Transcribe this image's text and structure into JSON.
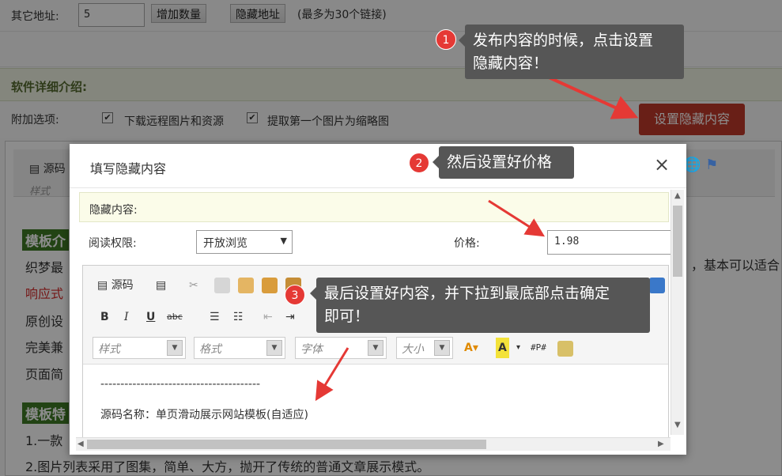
{
  "form": {
    "other_address_label": "其它地址:",
    "address_count_value": "5",
    "add_count_button": "增加数量",
    "hide_address_button": "隐藏地址",
    "max_links_note": "(最多为30个链接)",
    "software_detail_title": "软件详细介绍:",
    "extra_options_label": "附加选项:",
    "option_download_remote": "下载远程图片和资源",
    "option_first_thumb": "提取第一个图片为缩略图",
    "set_hidden_button": "设置隐藏内容"
  },
  "bg_editor": {
    "source_label": "源码",
    "style_placeholder": "样式",
    "lines": [
      "模板介",
      "织梦最",
      "响应式",
      "原创设",
      "完美兼",
      "页面简",
      "模板特",
      "1.一款",
      "2.图片列表采用了图集，简单、大方，抛开了传统的普通文章展示模式。"
    ],
    "right_fragment": "，基本可以适合"
  },
  "modal": {
    "title": "填写隐藏内容",
    "close_symbol": "×",
    "hidden_content_label": "隐藏内容:",
    "read_permission_label": "阅读权限:",
    "permission_value": "开放浏览",
    "price_label": "价格:",
    "price_value": "1.98",
    "editor": {
      "source_label": "源码",
      "style_placeholder": "样式",
      "format_placeholder": "格式",
      "font_placeholder": "字体",
      "size_placeholder": "大小",
      "divider_line": "----------------------------------------",
      "source_name_line": "源码名称：单页滑动展示网站模板(自适应)"
    }
  },
  "annotations": [
    {
      "number": "1",
      "text_line1": "发布内容的时候，点击设置",
      "text_line2": "隐藏内容！"
    },
    {
      "number": "2",
      "text_line1": "然后设置好价格"
    },
    {
      "number": "3",
      "text_line1": "最后设置好内容，并下拉到最底部点击确定",
      "text_line2": "即可！"
    }
  ],
  "colors": {
    "accent_red": "#c0392b",
    "badge_red": "#e53935",
    "callout_bg": "#565656",
    "section_green": "#556b2f"
  }
}
